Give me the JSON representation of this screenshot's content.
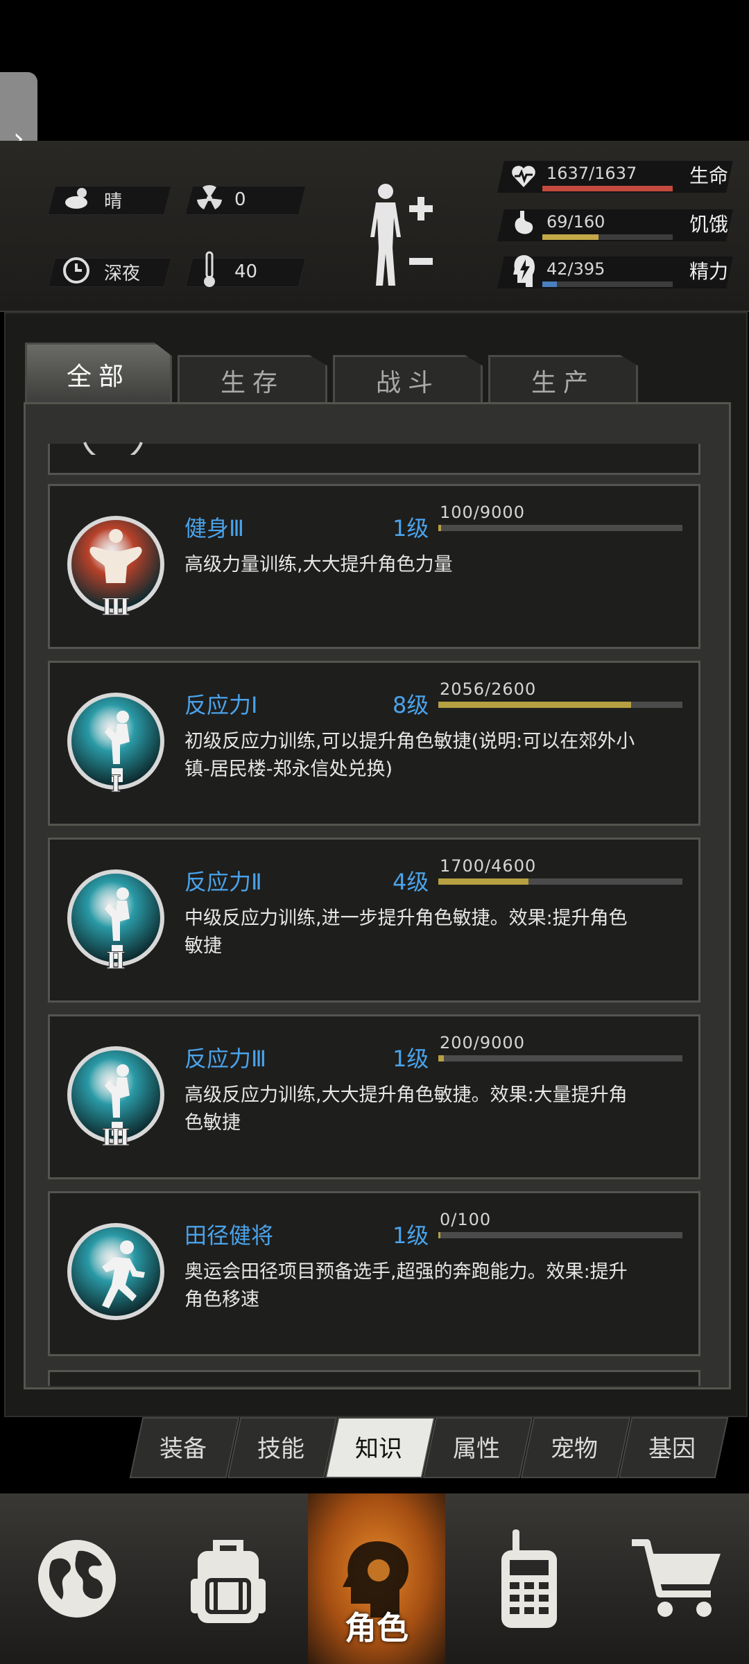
{
  "status": {
    "weather": {
      "icon": "cloud-sun-icon",
      "label": "晴"
    },
    "radiation": {
      "icon": "radiation-icon",
      "value": "0"
    },
    "time": {
      "icon": "clock-icon",
      "label": "深夜"
    },
    "temperature": {
      "icon": "thermometer-icon",
      "value": "40"
    },
    "body_icon": "body-figure-icon",
    "stats": [
      {
        "icon": "heartbeat-icon",
        "value": "1637/1637",
        "label": "生命",
        "fill": 1.0,
        "color": "#c54a3e"
      },
      {
        "icon": "stomach-icon",
        "value": "69/160",
        "label": "饥饿",
        "fill": 0.43,
        "color": "#c4a848"
      },
      {
        "icon": "head-energy-icon",
        "value": "42/395",
        "label": "精力",
        "fill": 0.11,
        "color": "#4a7fc0"
      }
    ]
  },
  "tabs": [
    {
      "label": "全部",
      "active": true
    },
    {
      "label": "生存",
      "active": false
    },
    {
      "label": "战斗",
      "active": false
    },
    {
      "label": "生产",
      "active": false
    }
  ],
  "skills": [
    {
      "name": "健身Ⅲ",
      "level": "1级",
      "progress": "100/9000",
      "fill": 0.011,
      "desc": "高级力量训练,大大提升角色力量",
      "icon": "bodybuilder-icon",
      "tier": "Ⅲ",
      "medal": "#b8412a"
    },
    {
      "name": "反应力Ⅰ",
      "level": "8级",
      "progress": "2056/2600",
      "fill": 0.79,
      "desc": "初级反应力训练,可以提升角色敏捷(说明:可以在郊外小镇-居民楼-郑永信处兑换)",
      "icon": "jumping-man-icon",
      "tier": "Ⅰ",
      "medal": "#2a9aa6"
    },
    {
      "name": "反应力Ⅱ",
      "level": "4级",
      "progress": "1700/4600",
      "fill": 0.37,
      "desc": "中级反应力训练,进一步提升角色敏捷。效果:提升角色敏捷",
      "icon": "jumping-man-icon",
      "tier": "Ⅱ",
      "medal": "#2a9aa6"
    },
    {
      "name": "反应力Ⅲ",
      "level": "1级",
      "progress": "200/9000",
      "fill": 0.022,
      "desc": "高级反应力训练,大大提升角色敏捷。效果:大量提升角色敏捷",
      "icon": "jumping-man-icon",
      "tier": "Ⅲ",
      "medal": "#2a9aa6"
    },
    {
      "name": "田径健将",
      "level": "1级",
      "progress": "0/100",
      "fill": 0.0,
      "desc": "奥运会田径项目预备选手,超强的奔跑能力。效果:提升角色移速",
      "icon": "runner-icon",
      "tier": "",
      "medal": "#2a9aa6"
    }
  ],
  "subtabs": [
    {
      "label": "装备",
      "active": false
    },
    {
      "label": "技能",
      "active": false
    },
    {
      "label": "知识",
      "active": true
    },
    {
      "label": "属性",
      "active": false
    },
    {
      "label": "宠物",
      "active": false
    },
    {
      "label": "基因",
      "active": false
    }
  ],
  "bottom_nav": [
    {
      "icon": "globe-icon",
      "label": ""
    },
    {
      "icon": "backpack-icon",
      "label": ""
    },
    {
      "icon": "character-head-icon",
      "label": "角色",
      "active": true
    },
    {
      "icon": "walkie-talkie-icon",
      "label": ""
    },
    {
      "icon": "cart-icon",
      "label": ""
    }
  ]
}
